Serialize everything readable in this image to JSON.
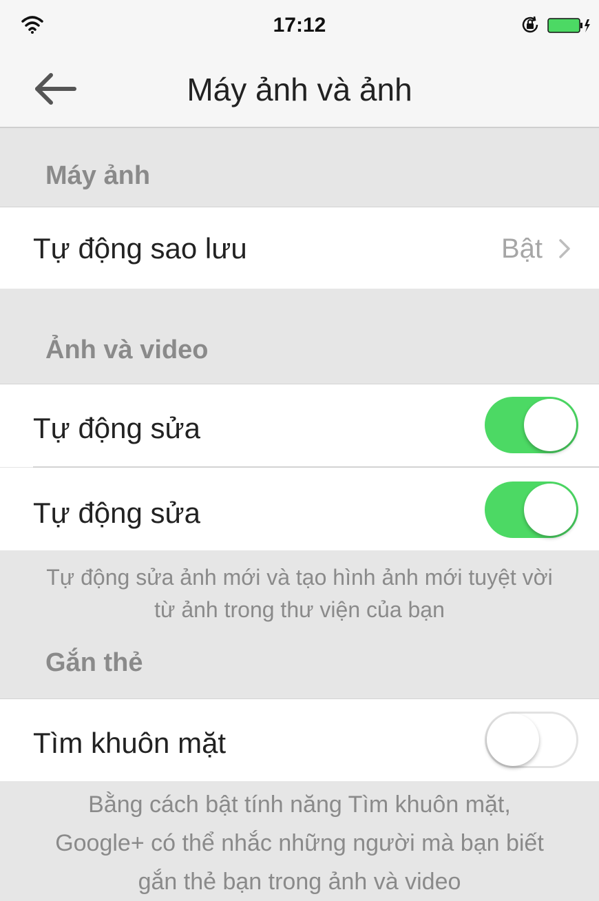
{
  "status_bar": {
    "time": "17:12",
    "icons": [
      "wifi-icon",
      "rotation-lock-icon",
      "battery-charging-icon"
    ],
    "battery_color": "#4cd964"
  },
  "nav": {
    "back_icon": "arrow-left-icon",
    "title": "Máy ảnh và ảnh"
  },
  "sections": {
    "camera": {
      "title": "Máy ảnh",
      "auto_backup": {
        "label": "Tự động sao lưu",
        "value": "Bật"
      }
    },
    "photos_videos": {
      "title": "Ảnh và video",
      "row1": {
        "label": "Tự động sửa",
        "state": "on"
      },
      "row2": {
        "label": "Tự động sửa",
        "state": "on"
      },
      "footnote": "Tự động sửa ảnh mới và tạo hình ảnh mới tuyệt vời từ ảnh trong thư viện của bạn"
    },
    "tagging": {
      "title": "Gắn thẻ",
      "find_faces": {
        "label": "Tìm khuôn mặt",
        "state": "off"
      },
      "footnote": "Bằng cách bật tính năng Tìm khuôn mặt, Google+ có thể nhắc những người mà bạn biết gắn thẻ bạn trong ảnh và video"
    }
  },
  "colors": {
    "toggle_on": "#4cd964",
    "background": "#e6e6e6",
    "secondary_text": "#8a8a8a"
  }
}
